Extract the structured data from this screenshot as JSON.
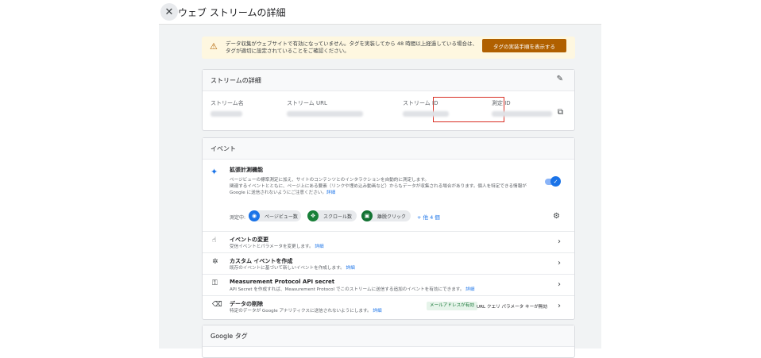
{
  "header": {
    "title": "ウェブ ストリームの詳細",
    "close_icon": "close-icon"
  },
  "banner": {
    "text": "データ収集がウェブサイトで有効になっていません。タグを実装してから 48 時間以上経過している場合は、タグが適切に設定されていることをご確認ください。",
    "button_label": "タグの実装手順を表示する",
    "accent_color": "#b06000"
  },
  "stream_details": {
    "title": "ストリームの詳細",
    "fields": [
      {
        "label": "ストリーム名"
      },
      {
        "label": "ストリーム URL"
      },
      {
        "label": "ストリーム ID"
      },
      {
        "label": "測定 ID"
      }
    ]
  },
  "events": {
    "title": "イベント",
    "enhanced": {
      "title": "拡張計測機能",
      "desc_line1": "ページビューの標準測定に加え、サイトのコンテンツとのインタラクションを自動的に測定します。",
      "desc_line2": "関連するイベントとともに、ページ上にある要素（リンクや埋め込み動画など）からもデータが収集される場合があります。個人を特定できる情報が",
      "desc_line3_prefix": "Google に送信されないようにご注意ください。",
      "link": "詳細",
      "toggle_on": true
    },
    "measuring": {
      "label": "測定中:",
      "chips": [
        {
          "label": "ページビュー数",
          "icon": "eye-icon",
          "color": "#1a73e8"
        },
        {
          "label": "スクロール数",
          "icon": "crosshair-icon",
          "color": "#188038"
        },
        {
          "label": "離脱クリック",
          "icon": "lock-icon",
          "color": "#137333"
        }
      ],
      "more": "+ 他 4 個"
    },
    "rows": [
      {
        "title": "イベントの変更",
        "desc": "受信イベントとパラメータを変更します。",
        "link": "詳細",
        "icon": "touch-icon"
      },
      {
        "title": "カスタム イベントを作成",
        "desc": "既存のイベントに基づいて新しいイベントを作成します。",
        "link": "詳細",
        "icon": "sparkle-click-icon"
      },
      {
        "title": "Measurement Protocol API secret",
        "desc": "API Secret を作成すれば、Measurement Protocol でこのストリームに送信する追加のイベントを有効にできます。",
        "link": "詳細",
        "icon": "key-icon"
      },
      {
        "title": "データの削除",
        "desc": "特定のデータが Google アナリティクスに送信されないようにします。",
        "link": "詳細",
        "icon": "eraser-icon",
        "badge": "メールアドレスが有効",
        "badge_text": "URL クエリ パラメータ キーが無効"
      }
    ]
  },
  "google_tag": {
    "title": "Google タグ"
  }
}
